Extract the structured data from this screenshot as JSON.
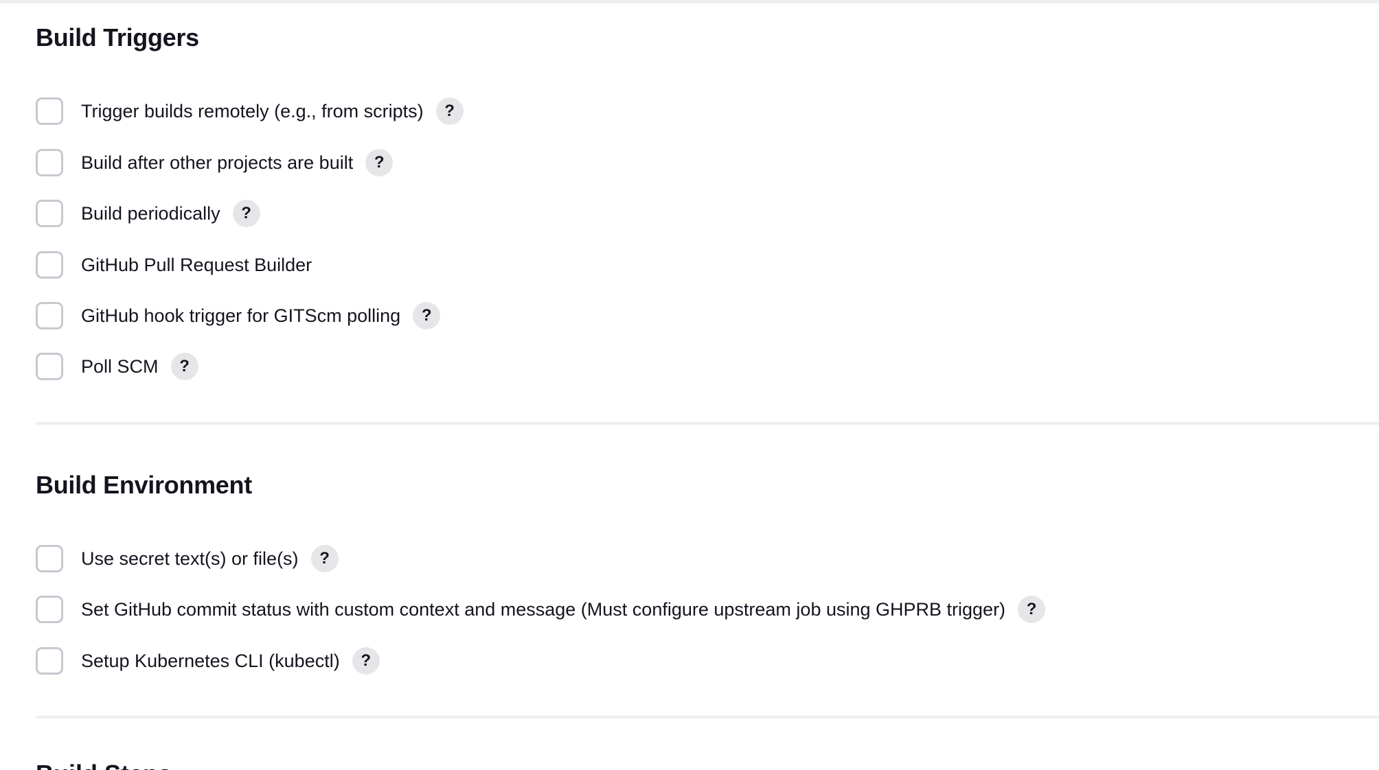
{
  "build_triggers": {
    "title": "Build Triggers",
    "items": [
      {
        "label": "Trigger builds remotely (e.g., from scripts)",
        "help": "?",
        "checked": false
      },
      {
        "label": "Build after other projects are built",
        "help": "?",
        "checked": false
      },
      {
        "label": "Build periodically",
        "help": "?",
        "checked": false
      },
      {
        "label": "GitHub Pull Request Builder",
        "checked": false
      },
      {
        "label": "GitHub hook trigger for GITScm polling",
        "help": "?",
        "checked": false
      },
      {
        "label": "Poll SCM",
        "help": "?",
        "checked": false
      }
    ]
  },
  "build_environment": {
    "title": "Build Environment",
    "items": [
      {
        "label": "Use secret text(s) or file(s)",
        "help": "?",
        "checked": false
      },
      {
        "label": "Set GitHub commit status with custom context and message (Must configure upstream job using GHPRB trigger)",
        "help": "?",
        "checked": false
      },
      {
        "label": "Setup Kubernetes CLI (kubectl)",
        "help": "?",
        "checked": false
      }
    ]
  },
  "next_section": {
    "title": "Build Steps"
  },
  "colors": {
    "text": "#14141f",
    "checkbox_border": "#c8c8d0",
    "help_bg": "#e6e6e9",
    "divider": "#efeff2"
  }
}
